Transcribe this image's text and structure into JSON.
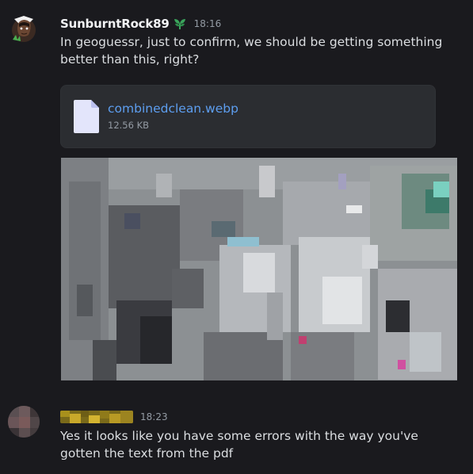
{
  "messages": [
    {
      "username": "SunburntRock89",
      "timestamp": "18:16",
      "text": "In geoguessr, just to confirm, we should be getting something better than this, right?",
      "role_icon": "leaf-icon",
      "attachment": {
        "file_name": "combinedclean.webp",
        "file_size": "12.56 KB",
        "icon": "file-icon"
      },
      "image": {
        "description_icon": "image-attachment"
      }
    },
    {
      "username": "",
      "timestamp": "18:23",
      "text": "Yes it looks like you have some errors with the way you've gotten the text from the pdf"
    }
  ],
  "colors": {
    "background": "#1a1a1e",
    "username": "#f2f3f5",
    "text": "#dbdee1",
    "timestamp": "#949ba4",
    "link": "#5d9ef0",
    "attachment_bg": "#2b2d31",
    "role_icon": "#3ba55c"
  }
}
